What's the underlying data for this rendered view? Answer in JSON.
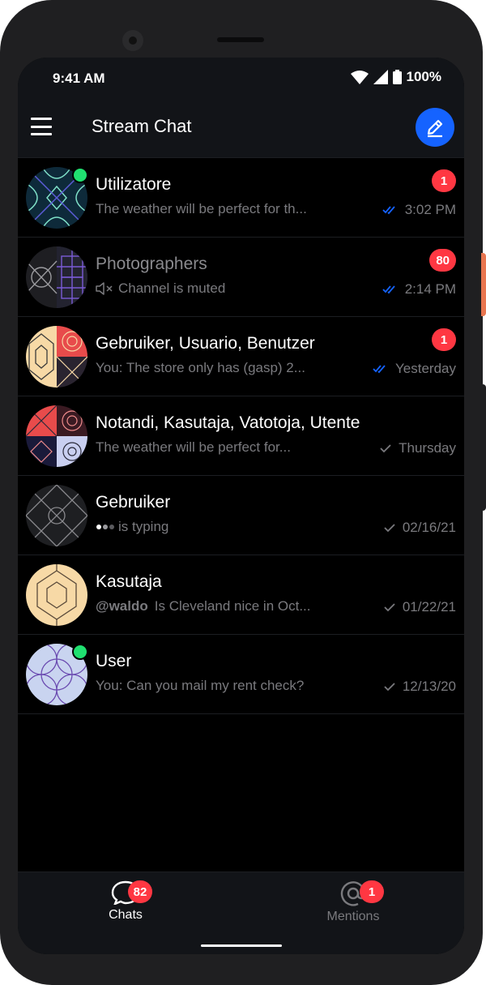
{
  "status": {
    "time": "9:41 AM",
    "battery": "100%"
  },
  "header": {
    "title": "Stream Chat"
  },
  "channels": [
    {
      "name": "Utilizatore",
      "preview": "The weather will be perfect for th...",
      "time": "3:02 PM",
      "unread": "1",
      "online": true
    },
    {
      "name": "Photographers",
      "preview": "Channel is muted",
      "time": "2:14 PM",
      "unread": "80",
      "muted": true
    },
    {
      "name": "Gebruiker, Usuario, Benutzer",
      "preview": "You: The store only has (gasp) 2...",
      "time": "Yesterday",
      "unread": "1"
    },
    {
      "name": "Notandi, Kasutaja, Vatotoja, Utente",
      "preview": "The weather will be perfect for...",
      "time": "Thursday"
    },
    {
      "name": "Gebruiker",
      "preview": "is typing",
      "time": "02/16/21"
    },
    {
      "name": "Kasutaja",
      "mention": "@waldo",
      "preview": "Is Cleveland nice in Oct...",
      "time": "01/22/21"
    },
    {
      "name": "User",
      "preview": "You: Can you mail my rent check?",
      "time": "12/13/20",
      "online": true
    }
  ],
  "tabs": {
    "chats": {
      "label": "Chats",
      "badge": "82"
    },
    "mentions": {
      "label": "Mentions",
      "badge": "1"
    }
  },
  "colors": {
    "accent": "#1563ff",
    "badge": "#ff3742",
    "online": "#20e070",
    "background": "#000000",
    "bar": "#121418"
  }
}
